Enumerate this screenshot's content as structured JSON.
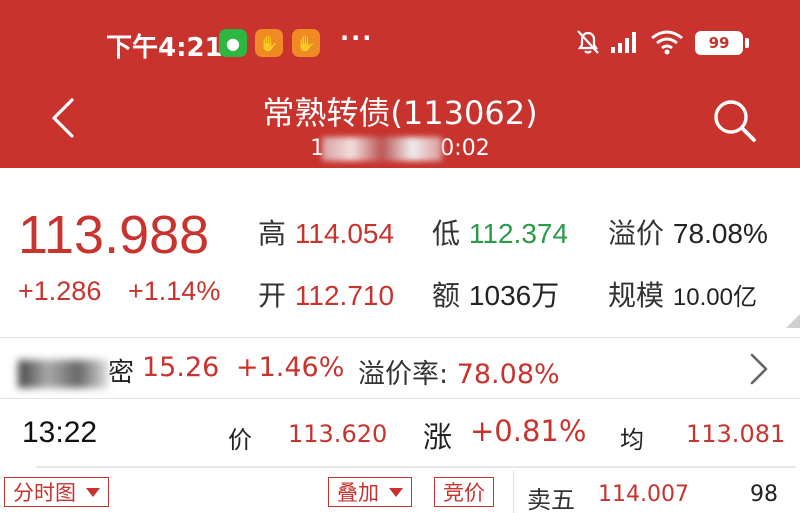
{
  "status_bar": {
    "time": "下午4:21",
    "more": "···",
    "battery": "99"
  },
  "header": {
    "title": "常熟转债(113062)",
    "subtitle_prefix": "1",
    "subtitle_suffix": "0:02"
  },
  "quote": {
    "price": "113.988",
    "change": "+1.286",
    "change_pct": "+1.14%",
    "high_label": "高",
    "high": "114.054",
    "low_label": "低",
    "low": "112.374",
    "premium_label": "溢价",
    "premium": "78.08%",
    "open_label": "开",
    "open": "112.710",
    "amount_label": "额",
    "amount": "1036万",
    "scale_label": "规模",
    "scale": "10.00亿"
  },
  "underlying": {
    "name_suffix": "密",
    "price": "15.26",
    "change_pct": "+1.46%",
    "premium_label": "溢价率:",
    "premium": "78.08%"
  },
  "tick": {
    "time": "13:22",
    "price_label": "价",
    "price": "113.620",
    "change_label": "涨",
    "change": "+0.81%",
    "avg_label": "均",
    "avg": "113.081"
  },
  "toolbar": {
    "chart_type": "分时图",
    "overlay": "叠加",
    "auction": "竞价"
  },
  "order_book": {
    "label": "卖五",
    "price": "114.007",
    "volume": "98"
  },
  "colors": {
    "header_bg": "#c8332e",
    "up": "#c8332e",
    "down": "#2a9a4a"
  }
}
